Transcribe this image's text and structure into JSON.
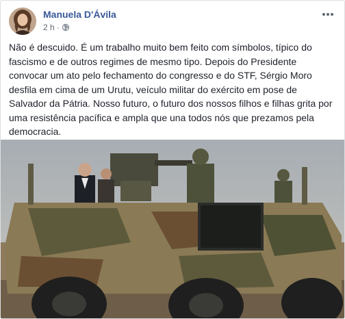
{
  "post": {
    "author": "Manuela D'Ávila",
    "time": "2 h",
    "separator": "·",
    "text": "Não é descuido. É um trabalho muito bem feito com símbolos, típico do fascismo e de outros regimes de mesmo tipo. Depois do Presidente convocar um ato pelo fechamento do congresso e do STF, Sérgio Moro desfila em cima de um Urutu, veículo militar do exército em pose de Salvador da Pátria. Nosso futuro, o futuro dos nossos filhos e filhas grita por uma resistência pacífica e ampla que una todos nós que prezamos pela democracia."
  },
  "icons": {
    "globe": "globe-icon",
    "more": "more-options-icon"
  },
  "colors": {
    "author": "#385898",
    "meta": "#616770",
    "text": "#1d2129",
    "border": "#dddfe2"
  }
}
